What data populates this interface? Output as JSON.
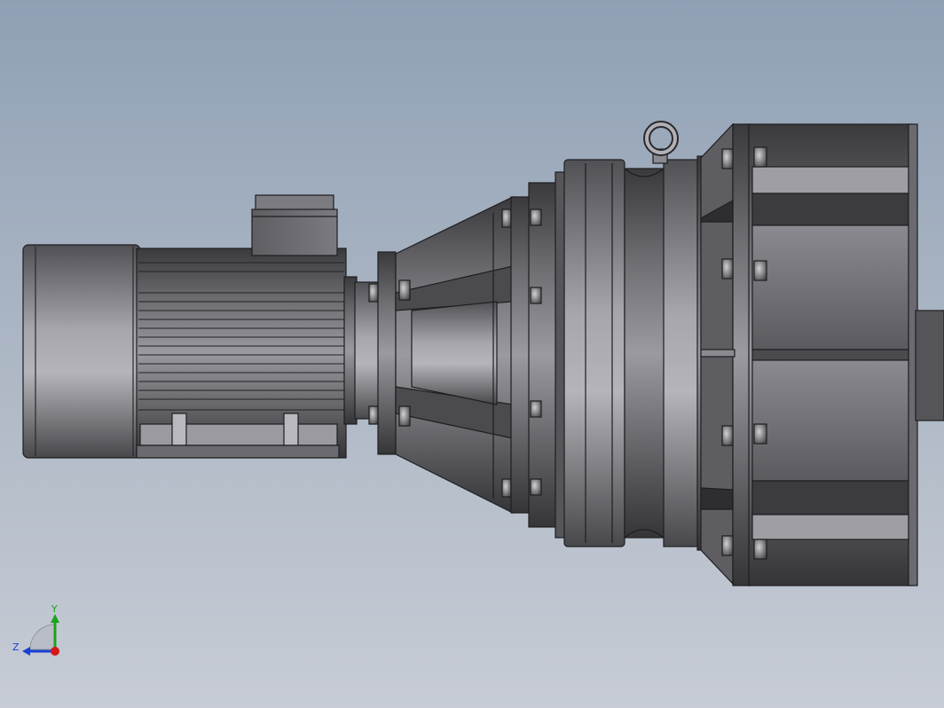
{
  "viewport": {
    "background_top": "#8fa0b5",
    "background_bottom": "#c7ccd5"
  },
  "model": {
    "parts": [
      "motor",
      "terminal-box",
      "coupling-adapter",
      "conical-housing",
      "planetary-gearbox",
      "lifting-eye",
      "output-housing"
    ]
  },
  "triad": {
    "y_label": "Y",
    "z_label": "Z",
    "y_color": "#1aa31a",
    "z_color": "#1a3fd6",
    "x_color": "#d41818"
  }
}
